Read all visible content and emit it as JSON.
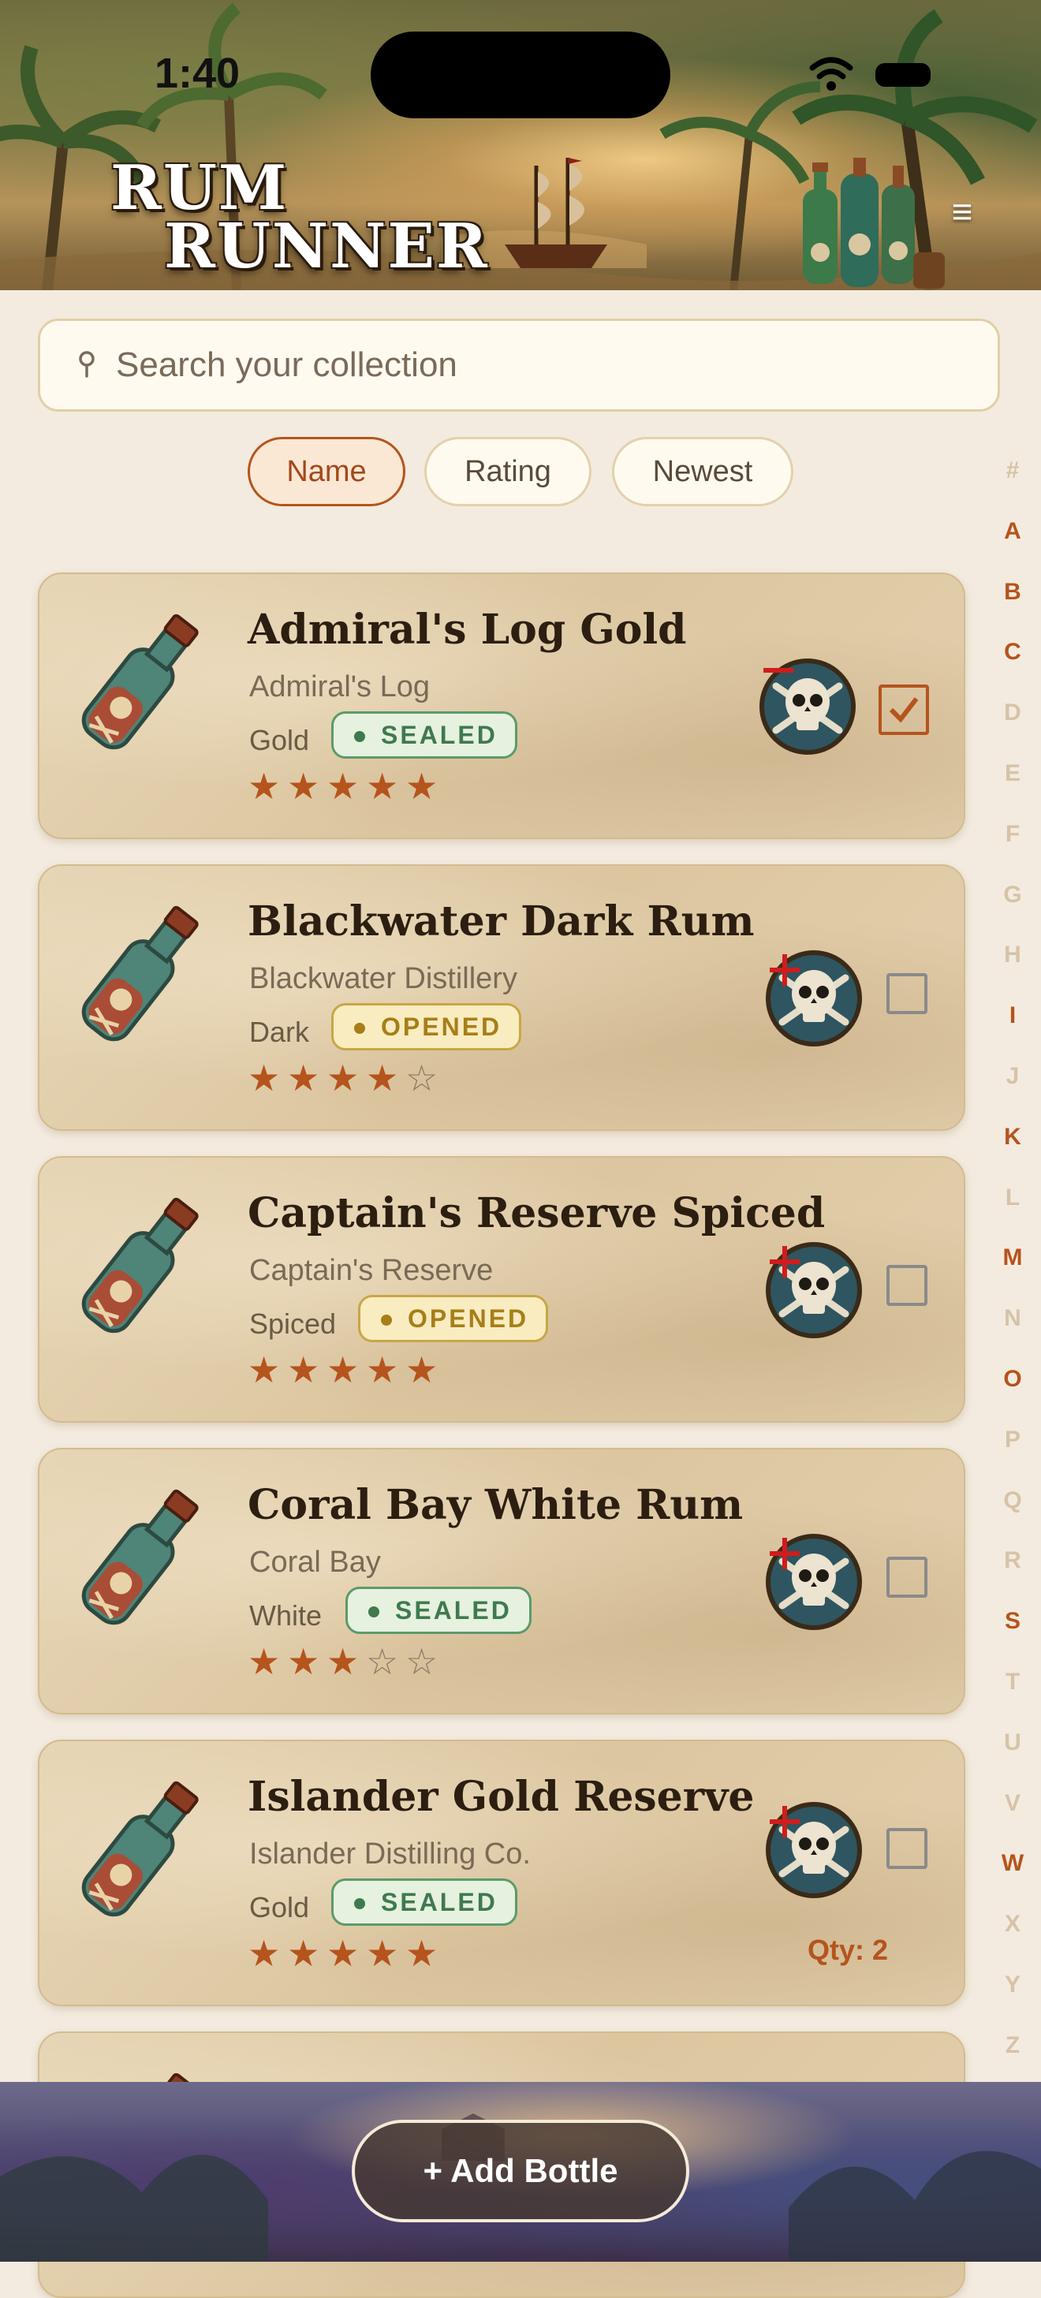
{
  "status_bar": {
    "time": "1:40"
  },
  "header": {
    "logo_line1": "RUM",
    "logo_line2": "RUNNER",
    "menu_icon": "hamburger-menu-icon"
  },
  "search": {
    "placeholder": "Search your collection",
    "icon": "search-icon"
  },
  "sort": {
    "options": [
      "Name",
      "Rating",
      "Newest"
    ],
    "selected": "Name"
  },
  "alphabet_index": {
    "letters": [
      "#",
      "A",
      "B",
      "C",
      "D",
      "E",
      "F",
      "G",
      "H",
      "I",
      "J",
      "K",
      "L",
      "M",
      "N",
      "O",
      "P",
      "Q",
      "R",
      "S",
      "T",
      "U",
      "V",
      "W",
      "X",
      "Y",
      "Z"
    ],
    "active": [
      "A",
      "B",
      "C",
      "I",
      "K",
      "M",
      "O",
      "S",
      "W"
    ]
  },
  "bottles": [
    {
      "name": "Admiral's Log Gold",
      "brand": "Admiral's Log",
      "type": "Gold",
      "status": "SEALED",
      "rating": 5,
      "selected": true,
      "qty": null
    },
    {
      "name": "Blackwater Dark Rum",
      "brand": "Blackwater Distillery",
      "type": "Dark",
      "status": "OPENED",
      "rating": 4,
      "selected": false,
      "qty": null
    },
    {
      "name": "Captain's Reserve Spiced",
      "brand": "Captain's Reserve",
      "type": "Spiced",
      "status": "OPENED",
      "rating": 5,
      "selected": false,
      "qty": null
    },
    {
      "name": "Coral Bay White Rum",
      "brand": "Coral Bay",
      "type": "White",
      "status": "SEALED",
      "rating": 3,
      "selected": false,
      "qty": null
    },
    {
      "name": "Islander Gold Reserve",
      "brand": "Islander Distilling Co.",
      "type": "Gold",
      "status": "SEALED",
      "rating": 5,
      "selected": false,
      "qty": "Qty: 2"
    }
  ],
  "add_button": {
    "label": "+ Add Bottle"
  },
  "colors": {
    "accent": "#b5541d",
    "sealed": "#3f7a4f",
    "opened": "#a77e18",
    "background": "#f3ebdf"
  }
}
